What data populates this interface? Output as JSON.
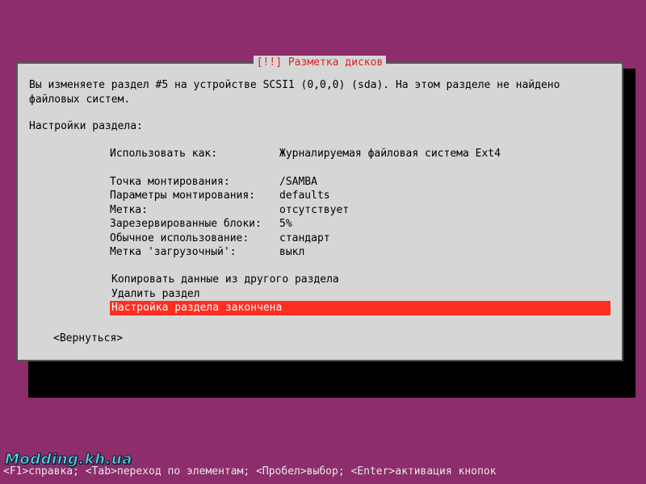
{
  "dialog": {
    "title": "[!!] Разметка дисков",
    "message": "Вы изменяете раздел #5 на устройстве SCSI1 (0,0,0) (sda). На этом разделе не найдено файловых систем.",
    "subheading": "Настройки раздела:",
    "settings": [
      {
        "key": "Использовать как:",
        "value": "Журналируемая файловая система Ext4"
      },
      {
        "key": "",
        "value": ""
      },
      {
        "key": "Точка монтирования:",
        "value": "/SAMBA"
      },
      {
        "key": "Параметры монтирования:",
        "value": "defaults"
      },
      {
        "key": "Метка:",
        "value": "отсутствует"
      },
      {
        "key": "Зарезервированные блоки:",
        "value": "5%"
      },
      {
        "key": "Обычное использование:",
        "value": "стандарт"
      },
      {
        "key": "Метка 'загрузочный':",
        "value": "выкл"
      }
    ],
    "actions": [
      {
        "label": "Копировать данные из другого раздела",
        "selected": false
      },
      {
        "label": "Удалить раздел",
        "selected": false
      },
      {
        "label": "Настройка раздела закончена",
        "selected": true
      }
    ],
    "back": "<Вернуться>"
  },
  "footer": "<F1>справка; <Tab>переход по элементам; <Пробел>выбор; <Enter>активация кнопок",
  "watermark": "Modding.kh.ua"
}
